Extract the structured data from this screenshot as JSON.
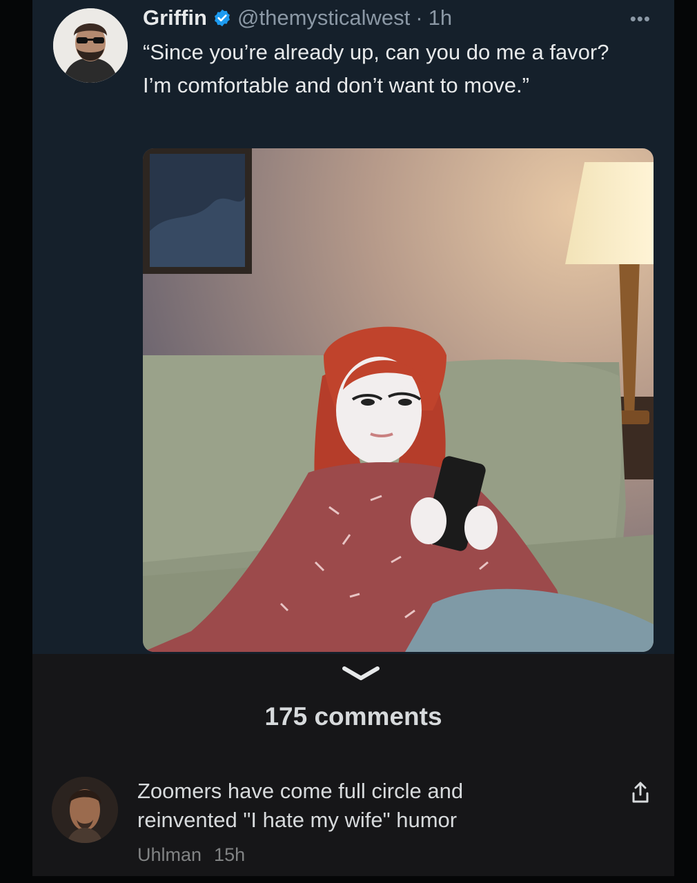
{
  "tweet": {
    "name": "Griffin",
    "handle": "@themysticalwest",
    "time": "1h",
    "text": "“Since you’re already up, can you do me a favor? I’m comfortable and don’t want to move.”",
    "more_icon": "more-dots-icon",
    "verified_icon": "verified-badge-icon"
  },
  "comments": {
    "count_label": "175 comments",
    "expand_icon": "chevron-down-icon",
    "items": [
      {
        "text": "Zoomers have come full circle and reinvented \"I hate my wife\" humor",
        "author": "Uhlman",
        "time": "15h",
        "share_icon": "share-icon"
      }
    ]
  },
  "colors": {
    "tweet_bg": "#15202b",
    "page_bg": "#161618",
    "verified": "#1d9bf0",
    "text_primary": "#e7e9ea",
    "text_secondary": "#8b98a5"
  }
}
